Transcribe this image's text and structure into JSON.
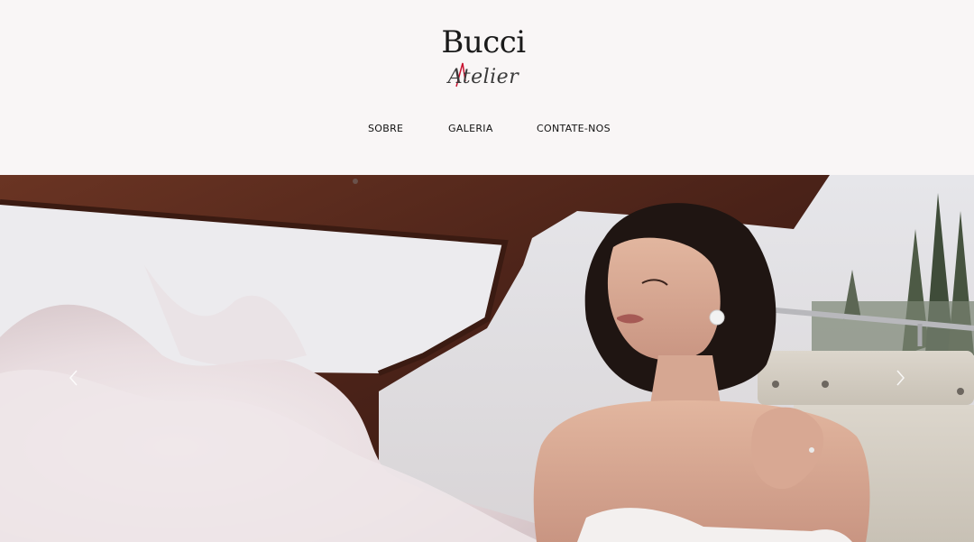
{
  "brand": {
    "name_top": "Bucci",
    "name_bottom": "Atelier",
    "accent_color": "#c8102e"
  },
  "nav": {
    "items": [
      {
        "label": "SOBRE"
      },
      {
        "label": "GALERIA"
      },
      {
        "label": "CONTATE-NOS"
      }
    ]
  },
  "hero": {
    "image_subject": "bride-in-boat",
    "prev_icon": "chevron-left-icon",
    "next_icon": "chevron-right-icon"
  },
  "colors": {
    "page_background": "#f9f6f6",
    "nav_text": "#111111"
  }
}
